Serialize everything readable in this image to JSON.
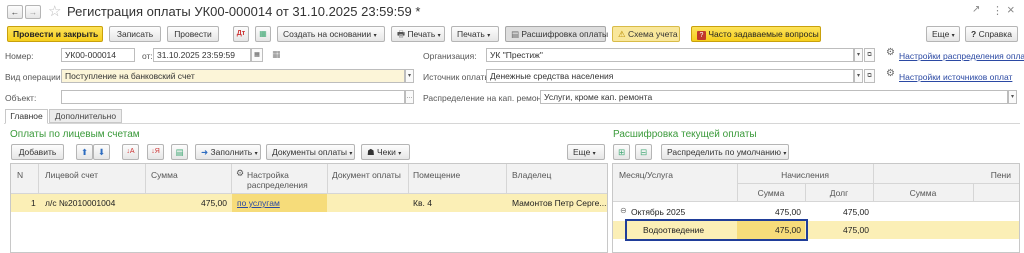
{
  "titlebar": {
    "title": "Регистрация оплаты УК00-000014 от 31.10.2025 23:59:59 *",
    "back": "←",
    "forward": "→",
    "star": "☆",
    "link_icon": "🔗",
    "more_icon": "⋮",
    "close_icon": "×"
  },
  "toolbar": {
    "post_close": "Провести и закрыть",
    "save": "Записать",
    "post": "Провести",
    "create_based": "Создать на основании",
    "print1": "Печать",
    "print2": "Печать",
    "payment_breakdown": "Расшифровка оплаты",
    "accounting_scheme": "Схема учета",
    "faq": "Часто задаваемые вопросы",
    "more": "Еще",
    "help": "Справка"
  },
  "header": {
    "number_label": "Номер:",
    "number_value": "УК00-000014",
    "from_label": "от:",
    "date_value": "31.10.2025 23:59:59",
    "org_label": "Организация:",
    "org_value": "УК \"Престиж\"",
    "dist_settings_link": "Настройки распределения оплат",
    "op_label": "Вид операции:",
    "op_value": "Поступление на банковский счет",
    "source_label": "Источник оплаты:",
    "source_value": "Денежные средства населения",
    "source_settings_link": "Настройки источников оплат",
    "object_label": "Объект:",
    "object_value": "",
    "capital_label": "Распределение на кап. ремонт:",
    "capital_value": "Услуги, кроме кап. ремонта"
  },
  "tabs": [
    "Главное",
    "Дополнительно"
  ],
  "left": {
    "title": "Оплаты по лицевым счетам",
    "add": "Добавить",
    "fill": "Заполнить",
    "payment_docs": "Документы оплаты",
    "checks": "Чеки",
    "more": "Еще",
    "columns": [
      "N",
      "Лицевой счет",
      "Сумма",
      "Настройка распределения",
      "Документ оплаты",
      "Помещение",
      "Владелец"
    ],
    "rows": [
      {
        "n": "1",
        "account": "л/с №2010001004",
        "sum": "475,00",
        "setting": "по услугам",
        "doc": "",
        "premises": "Кв. 4",
        "owner": "Мамонтов Петр Серге..."
      }
    ]
  },
  "right": {
    "title": "Расшифровка текущей оплаты",
    "distribute_default": "Распределить по умолчанию",
    "col_month": "Месяц/Услуга",
    "col_accruals": "Начисления",
    "col_penalty": "Пени",
    "sub_sum": "Сумма",
    "sub_debt": "Долг",
    "sub_penalty_sum": "Сумма",
    "month_row": {
      "label": "Октябрь 2025",
      "sum": "475,00",
      "debt": "475,00"
    },
    "service_row": {
      "label": "Водоотведение",
      "sum": "475,00",
      "debt": "475,00"
    }
  },
  "colors": {
    "accent_green": "#3a9a3a",
    "selected_row": "#fbefb6",
    "focus_border": "#1f3d99",
    "link": "#2b49a3"
  }
}
